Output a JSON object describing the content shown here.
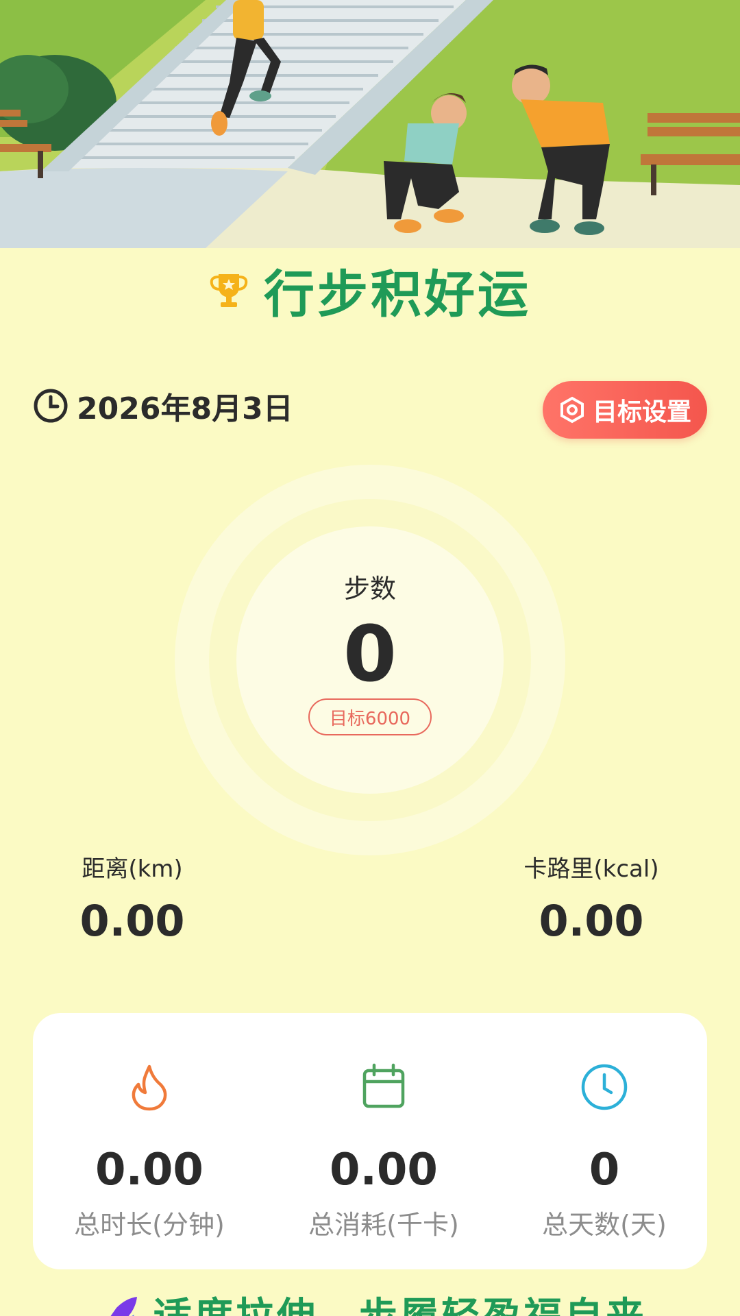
{
  "header": {
    "title": "行步积好运"
  },
  "date_row": {
    "date": "2026年8月3日",
    "goal_button_label": "目标设置"
  },
  "steps": {
    "label": "步数",
    "value": "0",
    "target": "目标6000"
  },
  "metrics": {
    "distance_label": "距离(km)",
    "distance_value": "0.00",
    "calorie_label": "卡路里(kcal)",
    "calorie_value": "0.00"
  },
  "summary": {
    "stats": [
      {
        "icon": "flame-icon",
        "value": "0.00",
        "label": "总时长(分钟)",
        "color": "#f07a3a"
      },
      {
        "icon": "calendar-icon",
        "value": "0.00",
        "label": "总消耗(千卡)",
        "color": "#4fa35f"
      },
      {
        "icon": "clock-icon",
        "value": "0",
        "label": "总天数(天)",
        "color": "#2cb0d8"
      }
    ]
  },
  "bottom_banner": {
    "text": "适度拉伸，步履轻盈福自来"
  },
  "colors": {
    "background": "#fbfac4",
    "title_green": "#1f9a57",
    "accent_red": "#f4564d"
  }
}
